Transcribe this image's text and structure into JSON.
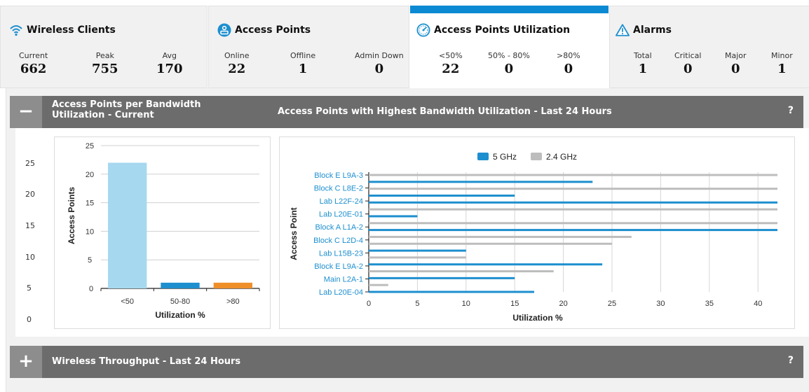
{
  "tiles": {
    "wireless_clients": {
      "title": "Wireless Clients",
      "icon": "wifi-icon",
      "stats": [
        {
          "label": "Current",
          "value": "662"
        },
        {
          "label": "Peak",
          "value": "755"
        },
        {
          "label": "Avg",
          "value": "170"
        }
      ]
    },
    "access_points": {
      "title": "Access Points",
      "icon": "access-point-icon",
      "stats": [
        {
          "label": "Online",
          "value": "22"
        },
        {
          "label": "Offline",
          "value": "1"
        },
        {
          "label": "Admin Down",
          "value": "0"
        }
      ]
    },
    "utilization": {
      "title": "Access Points Utilization",
      "icon": "gauge-icon",
      "stats": [
        {
          "label": "<50%",
          "value": "22"
        },
        {
          "label": "50% - 80%",
          "value": "0"
        },
        {
          "label": ">80%",
          "value": "0"
        }
      ]
    },
    "alarms": {
      "title": "Alarms",
      "icon": "warning-icon",
      "stats": [
        {
          "label": "Total",
          "value": "1"
        },
        {
          "label": "Critical",
          "value": "0"
        },
        {
          "label": "Major",
          "value": "0"
        },
        {
          "label": "Minor",
          "value": "1"
        }
      ]
    }
  },
  "panel1": {
    "toggle": "−",
    "left_title": "Access Points per Bandwidth Utilization - Current",
    "right_title": "Access Points with Highest Bandwidth Utilization - Last 24 Hours",
    "help": "?"
  },
  "panel2": {
    "toggle": "+",
    "title": "Wireless Throughput - Last 24 Hours",
    "help": "?"
  },
  "outer_axis_ticks": [
    "25",
    "20",
    "15",
    "10",
    "5",
    "0"
  ],
  "chart_data": [
    {
      "type": "bar",
      "categories": [
        "<50",
        "50-80",
        ">80"
      ],
      "values": [
        22,
        1,
        1
      ],
      "colors": [
        "#a6d8f0",
        "#1d8fcf",
        "#ef8f2a"
      ],
      "xlabel": "Utilization %",
      "ylabel": "Access Points",
      "ylim": [
        0,
        25
      ],
      "yticks": [
        "0",
        "5",
        "10",
        "15",
        "20",
        "25"
      ],
      "grid": true
    },
    {
      "type": "bar",
      "orientation": "horizontal",
      "categories": [
        "Block E L9A-3",
        "Block C L8E-2",
        "Lab L22F-24",
        "Lab L20E-01",
        "Block A L1A-2",
        "Block C L2D-4",
        "Lab L15B-23",
        "Block E L9A-2",
        "Main L2A-1",
        "Lab L20E-04"
      ],
      "series": [
        {
          "name": "5 GHz",
          "color": "#1d8fcf",
          "values": [
            23,
            0,
            15,
            42,
            5,
            42,
            0,
            10,
            24,
            15,
            17
          ]
        },
        {
          "name": "2.4 GHz",
          "color": "#bdbdbd",
          "values": [
            42,
            42,
            0,
            42,
            0,
            27,
            25,
            10,
            19,
            2,
            0
          ]
        }
      ],
      "bars": [
        {
          "series": 1,
          "value": 42
        },
        {
          "series": 0,
          "value": 23
        },
        {
          "series": 1,
          "value": 42
        },
        {
          "series": 0,
          "value": 15
        },
        {
          "series": 0,
          "value": 42
        },
        {
          "series": 1,
          "value": 42
        },
        {
          "series": 0,
          "value": 5
        },
        {
          "series": 1,
          "value": 42
        },
        {
          "series": 0,
          "value": 42
        },
        {
          "series": 1,
          "value": 27
        },
        {
          "series": 1,
          "value": 25
        },
        {
          "series": 0,
          "value": 10
        },
        {
          "series": 1,
          "value": 10
        },
        {
          "series": 0,
          "value": 24
        },
        {
          "series": 1,
          "value": 19
        },
        {
          "series": 0,
          "value": 15
        },
        {
          "series": 1,
          "value": 2
        },
        {
          "series": 0,
          "value": 17
        }
      ],
      "xlabel": "Utilization %",
      "ylabel": "Access Point",
      "xlim": [
        0,
        42
      ],
      "xticks": [
        "0",
        "5",
        "10",
        "15",
        "20",
        "25",
        "30",
        "35",
        "40"
      ],
      "legend": "top-center",
      "grid": true
    }
  ]
}
